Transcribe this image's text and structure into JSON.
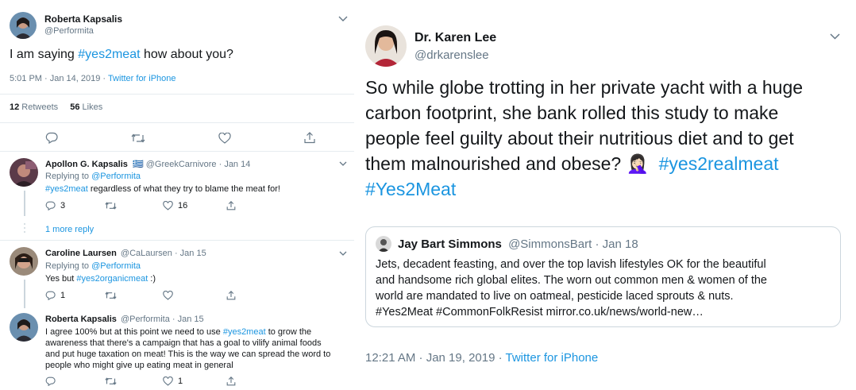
{
  "left": {
    "main": {
      "name": "Roberta Kapsalis",
      "handle": "@Performita",
      "text_prefix": "I am saying ",
      "text_hashtag": "#yes2meat",
      "text_suffix": " how about you?",
      "time": "5:01 PM · Jan 14, 2019 · ",
      "source": "Twitter for iPhone",
      "retweets_count": "12",
      "retweets_label": " Retweets",
      "likes_count": "56",
      "likes_label": " Likes"
    },
    "replies": [
      {
        "name": "Apollon G. Kapsalis",
        "meta": "@GreekCarnivore · Jan 14",
        "replying_prefix": "Replying to ",
        "replying_handle": "@Performita",
        "hashtag": "#yes2meat",
        "text": " regardless of what they try to blame the meat for!",
        "replies": "3",
        "likes": "16",
        "more_replies": "1 more reply"
      },
      {
        "name": "Caroline Laursen",
        "meta": "@CaLaursen · Jan 15",
        "replying_prefix": "Replying to ",
        "replying_handle": "@Performita",
        "text_prefix": "Yes but ",
        "hashtag": "#yes2organicmeat",
        "text_suffix": " :)",
        "replies": "1"
      },
      {
        "name": "Roberta Kapsalis",
        "meta": "@Performita · Jan 15",
        "line1_prefix": "I agree 100% but at this point we need to use ",
        "line1_hashtag": "#yes2meat",
        "line1_suffix": " to grow the",
        "line2": "awareness that there's a campaign that has a goal to vilify animal foods",
        "line3": "and put huge taxation on meat! This is the way we can spread the word to",
        "line4": "people who might give up eating meat in general",
        "likes": "1"
      }
    ]
  },
  "right": {
    "name": "Dr. Karen Lee",
    "handle": "@drkarenslee",
    "line1": "So while globe trotting in her private yacht with a huge",
    "line2": "carbon footprint, she bank rolled this study to make",
    "line3": "people feel guilty about their nutritious diet and to get",
    "line4_text": "them malnourished and obese? ",
    "line4_emoji": "🤦🏻‍♀️",
    "line4_hashtag": "#yes2realmeat",
    "line5_hashtag": "#Yes2Meat",
    "quote": {
      "name": "Jay Bart Simmons",
      "meta": "@SimmonsBart · Jan 18",
      "line1": "Jets, decadent feasting, and over the top lavish lifestyles OK for the beautiful",
      "line2": "and handsome rich global elites.  The worn out common men & women of the",
      "line3": "world are mandated to live on oatmeal, pesticide laced sprouts & nuts.",
      "line4": "#Yes2Meat #CommonFolkResist  mirror.co.uk/news/world-new…"
    },
    "time": "12:21 AM · Jan 19, 2019 · ",
    "source": "Twitter for iPhone"
  },
  "colors": {
    "accent": "#1b95e0",
    "secondary": "#657786",
    "border": "#e6ecf0"
  }
}
